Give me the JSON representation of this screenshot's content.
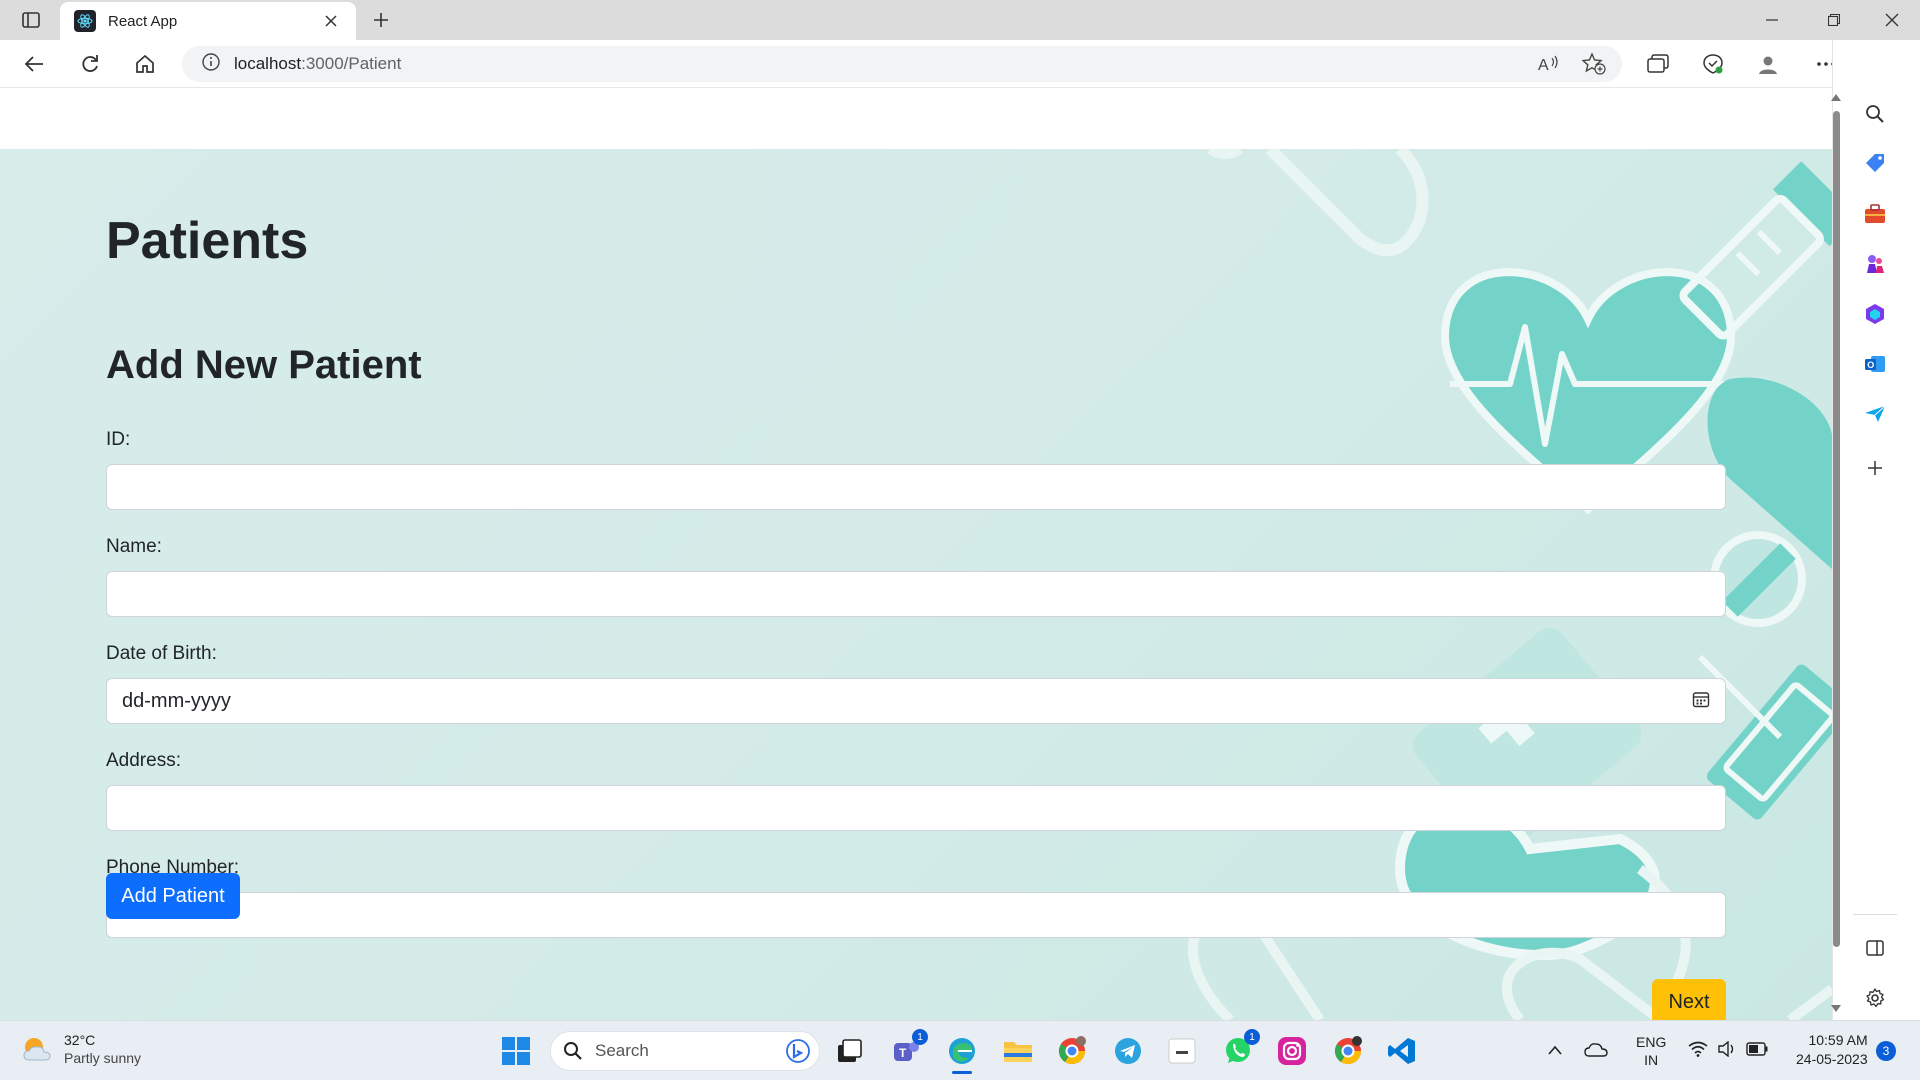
{
  "browser": {
    "tab_title": "React App",
    "url_host": "localhost",
    "url_path": ":3000/Patient"
  },
  "page": {
    "title": "Patients",
    "form_title": "Add New Patient",
    "fields": [
      {
        "label": "ID:",
        "value": "",
        "placeholder": ""
      },
      {
        "label": "Name:",
        "value": "",
        "placeholder": ""
      },
      {
        "label": "Date of Birth:",
        "value": "dd-mm-yyyy"
      },
      {
        "label": "Address:",
        "value": "",
        "placeholder": ""
      },
      {
        "label": "Phone Number:",
        "value": "",
        "placeholder": ""
      }
    ],
    "add_button": "Add Patient",
    "next_button": "Next"
  },
  "taskbar": {
    "weather_temp": "32°C",
    "weather_condition": "Partly sunny",
    "search_label": "Search",
    "lang_top": "ENG",
    "lang_bottom": "IN",
    "time": "10:59 AM",
    "date": "24-05-2023",
    "notification_count": "3",
    "teams_badge": "1",
    "whatsapp_badge": "1"
  },
  "colors": {
    "primary": "#0d6efd",
    "warning": "#ffc107",
    "hero_bg": "#d3ebe8",
    "decor": "#72d2c7"
  }
}
